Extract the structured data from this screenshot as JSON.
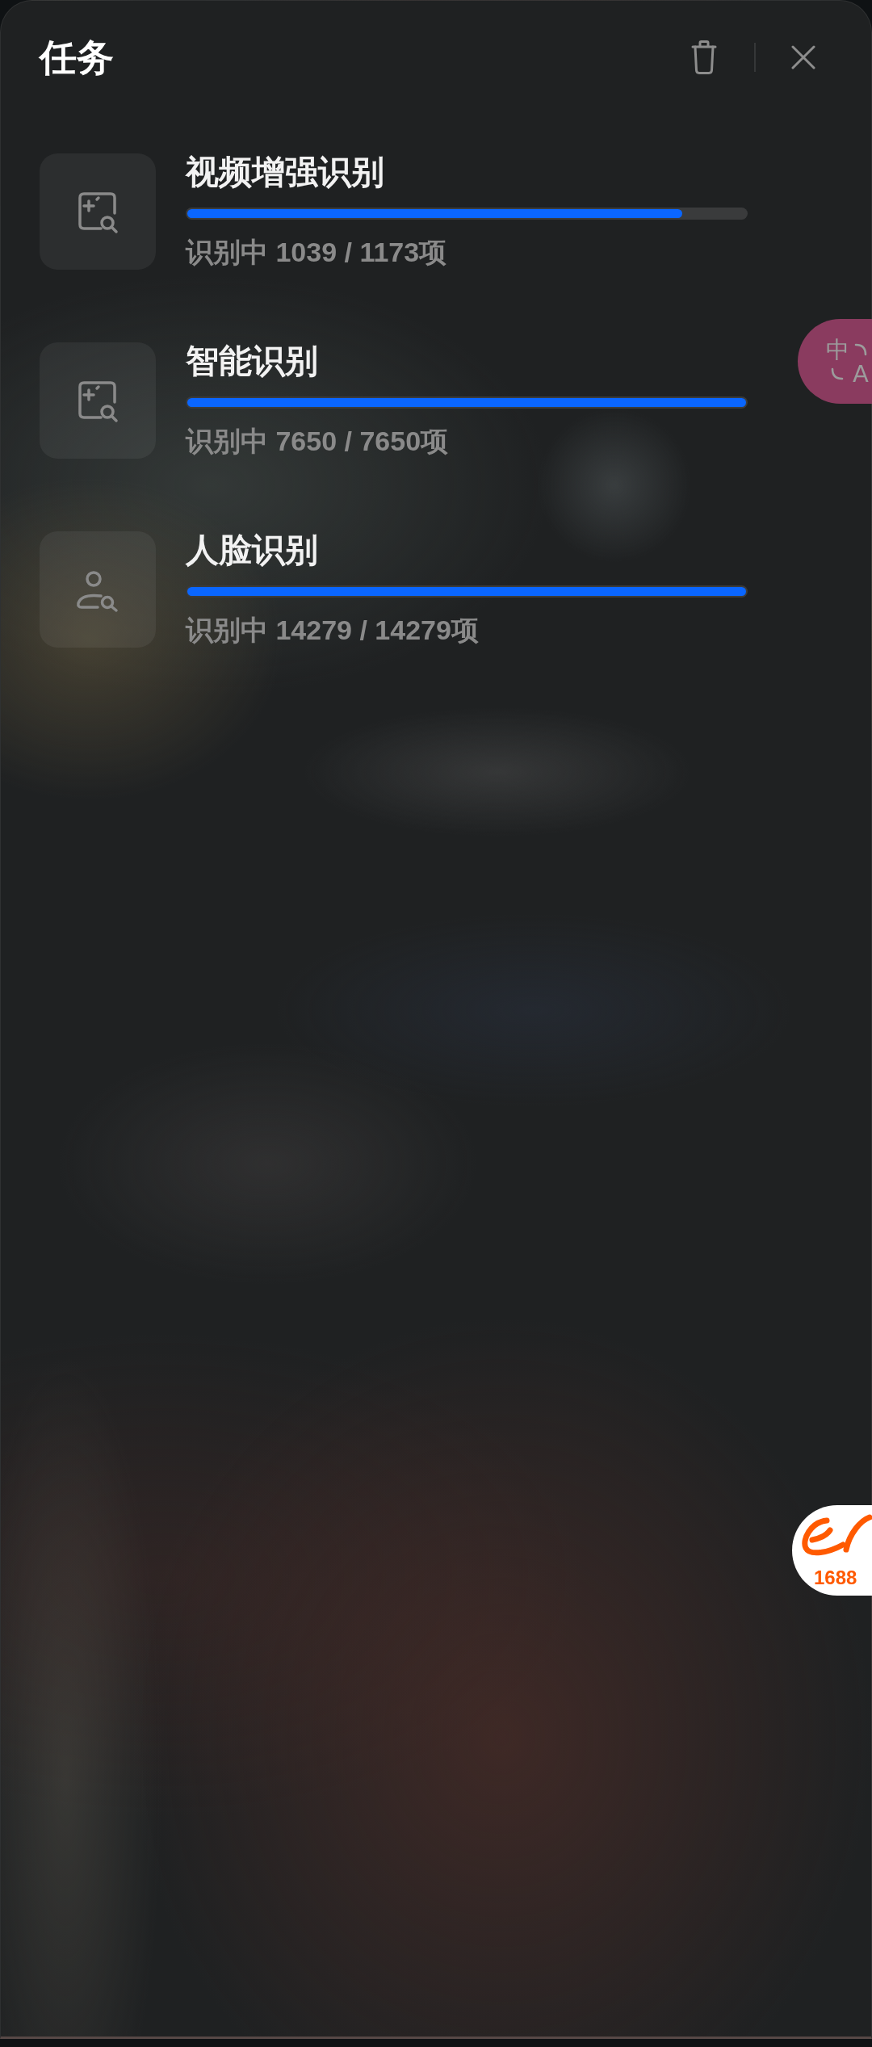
{
  "header": {
    "title": "任务"
  },
  "tasks": [
    {
      "kind": "image",
      "title": "视频增强识别",
      "level": 0.886,
      "status": "识别中 1039 / 1173项"
    },
    {
      "kind": "image",
      "title": "智能识别",
      "level": 1,
      "status": "识别中 7650 / 7650项"
    },
    {
      "kind": "person",
      "title": "人脸识别",
      "level": 1,
      "status": "识别中 14279 / 14279项"
    }
  ],
  "translate_button": {
    "glyphs": [
      "中",
      "A"
    ]
  },
  "logo_button": {
    "label": "1688"
  }
}
